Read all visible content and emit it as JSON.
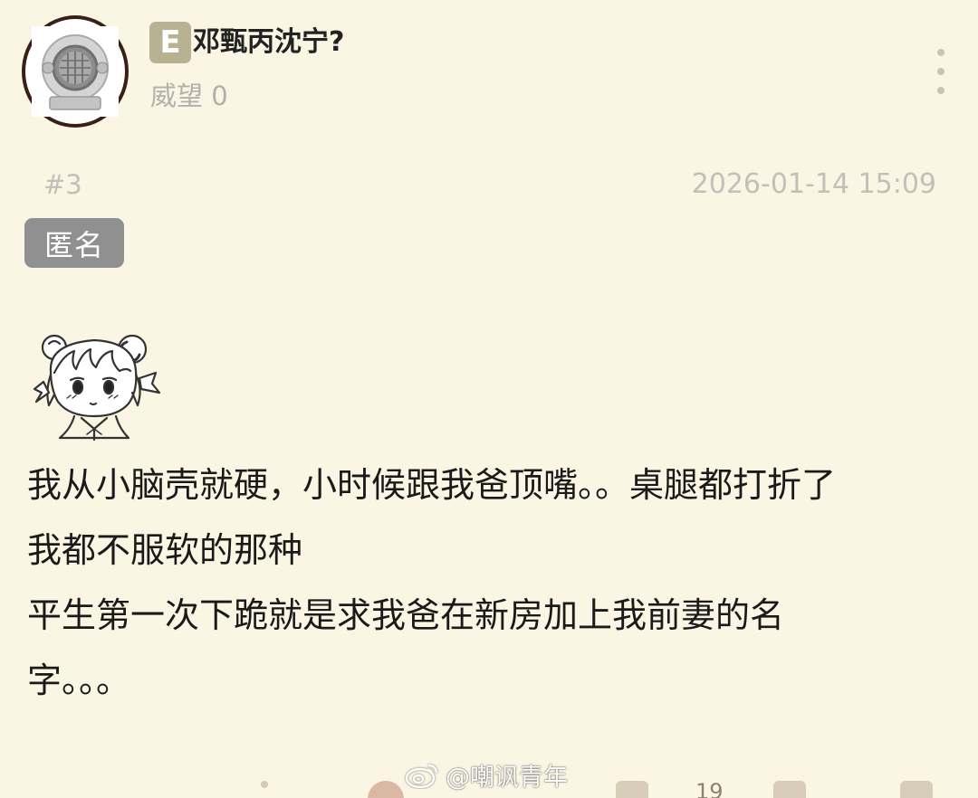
{
  "post": {
    "author": {
      "level_badge": "E",
      "username": "邓甄丙沈宁?",
      "reputation": "威望 0"
    },
    "floor": "#3",
    "timestamp": "2026-01-14 15:09",
    "anonymous_label": "匿名",
    "body_lines": [
      "我从小脑壳就硬，小时候跟我爸顶嘴。。桌腿都打折了",
      "我都不服软的那种",
      "平生第一次下跪就是求我爸在新房加上我前妻的名",
      "字。。。"
    ],
    "like_count": "19"
  },
  "watermark": {
    "text": "@嘲讽青年"
  },
  "colors": {
    "background": "#fbf5e3",
    "badge_gray": "#909090",
    "level_badge": "#b8b293",
    "muted_text": "#c2c0b8"
  },
  "icons": {
    "avatar": "diving-helmet-avatar",
    "menu": "more-vertical-icon",
    "sticker": "anime-girl-sticker",
    "watermark": "weibo-logo-icon"
  }
}
